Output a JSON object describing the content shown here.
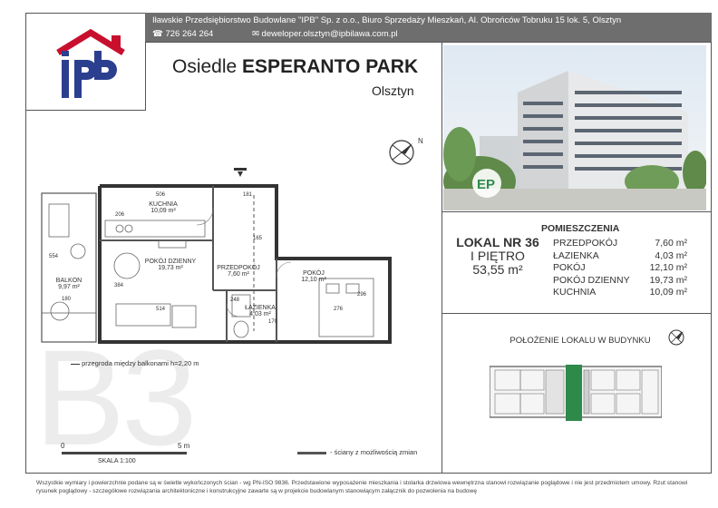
{
  "header": {
    "company": "Iławskie Przedsiębiorstwo Budowlane \"IPB\" Sp. z o.o., Biuro Sprzedaży Mieszkań, Al. Obrońców Tobruku 15 lok. 5, Olsztyn",
    "phone": "☎ 726 264 264",
    "email": "✉ deweloper.olsztyn@ipbilawa.com.pl"
  },
  "logo": {
    "text": "ipb"
  },
  "project": {
    "prefix": "Osiedle",
    "name": "ESPERANTO PARK",
    "city": "Olsztyn"
  },
  "photo_logo": "EP",
  "unit": {
    "number": "LOKAL NR 36",
    "floor": "I PIĘTRO",
    "area": "53,55 m²"
  },
  "rooms_heading": "POMIESZCZENIA",
  "rooms": [
    {
      "name": "PRZEDPOKÓJ",
      "area": "7,60 m²"
    },
    {
      "name": "ŁAZIENKA",
      "area": "4,03 m²"
    },
    {
      "name": "POKÓJ",
      "area": "12,10 m²"
    },
    {
      "name": "POKÓJ DZIENNY",
      "area": "19,73 m²"
    },
    {
      "name": "KUCHNIA",
      "area": "10,09 m²"
    }
  ],
  "position_title": "POŁOŻENIE LOKALU W BUDYNKU",
  "plan": {
    "kitchen": "KUCHNIA",
    "kitchen_area": "10,09 m²",
    "living": "POKÓJ DZIENNY",
    "living_area": "19,73 m²",
    "hall": "PRZEDPOKÓJ",
    "hall_area": "7,60 m²",
    "room": "POKÓJ",
    "room_area": "12,10 m²",
    "bath": "ŁAZIENKA",
    "bath_area": "4,03 m²",
    "balcony": "BALKON",
    "balcony_area": "9,97 m²",
    "dims": [
      "506",
      "181",
      "206",
      "554",
      "384",
      "180",
      "514",
      "248",
      "170",
      "276",
      "296",
      "165"
    ],
    "partition_note": "przegroda między balkonami h=2,20 m"
  },
  "building_code": "B3",
  "scale": {
    "zero": "0",
    "five": "5 m",
    "label": "SKALA 1:100"
  },
  "walls_note": "- ściany z możliwością zmian",
  "footer": "Wszystkie wymiary i powierzchnie podane są w świetle wykończonych ścian - wg PN-ISO 9836. Przedstawione wyposażenie mieszkania i stolarka drzwiowa wewnętrzna stanowi rozwiązanie poglądowe i nie jest przedmiotem umowy. Rzut stanowi rysunek poglądowy - szczegółowe rozwiązania architektoniczne i konstrukcyjne zawarte są w projekcie budowlanym stanowiącym załącznik do pozwolenia na budowę",
  "colors": {
    "accent_red": "#c8102e",
    "logo_blue": "#2b3f8f",
    "highlight_green": "#2e8a4a",
    "header_gray": "#6e6e6e"
  }
}
